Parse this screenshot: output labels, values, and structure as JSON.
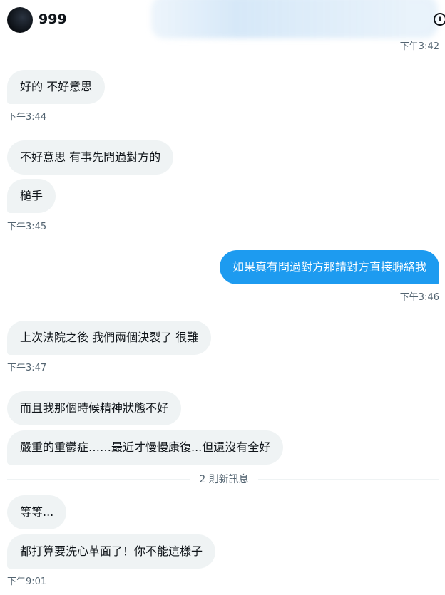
{
  "header": {
    "name": "999",
    "info_icon": "info-icon"
  },
  "messages": {
    "ts_0": "下午3:42",
    "m1": "好的 不好意思",
    "ts_1": "下午3:44",
    "m2": "不好意思 有事先問過對方的",
    "m3": "槌手",
    "ts_2": "下午3:45",
    "m4": "如果真有問過對方那請對方直接聯絡我",
    "ts_3": "下午3:46",
    "m5": "上次法院之後 我們兩個決裂了 很難",
    "ts_4": "下午3:47",
    "m6": "而且我那個時候精神狀態不好",
    "m7": "嚴重的重鬱症……最近才慢慢康復...但還沒有全好",
    "divider": "2 則新訊息",
    "m8": "等等...",
    "m9": "都打算要洗心革面了！你不能這樣子",
    "ts_5": "下午9:01"
  },
  "colors": {
    "outgoing": "#1d9bf0",
    "incoming": "#eff3f4",
    "muted": "#536471"
  }
}
